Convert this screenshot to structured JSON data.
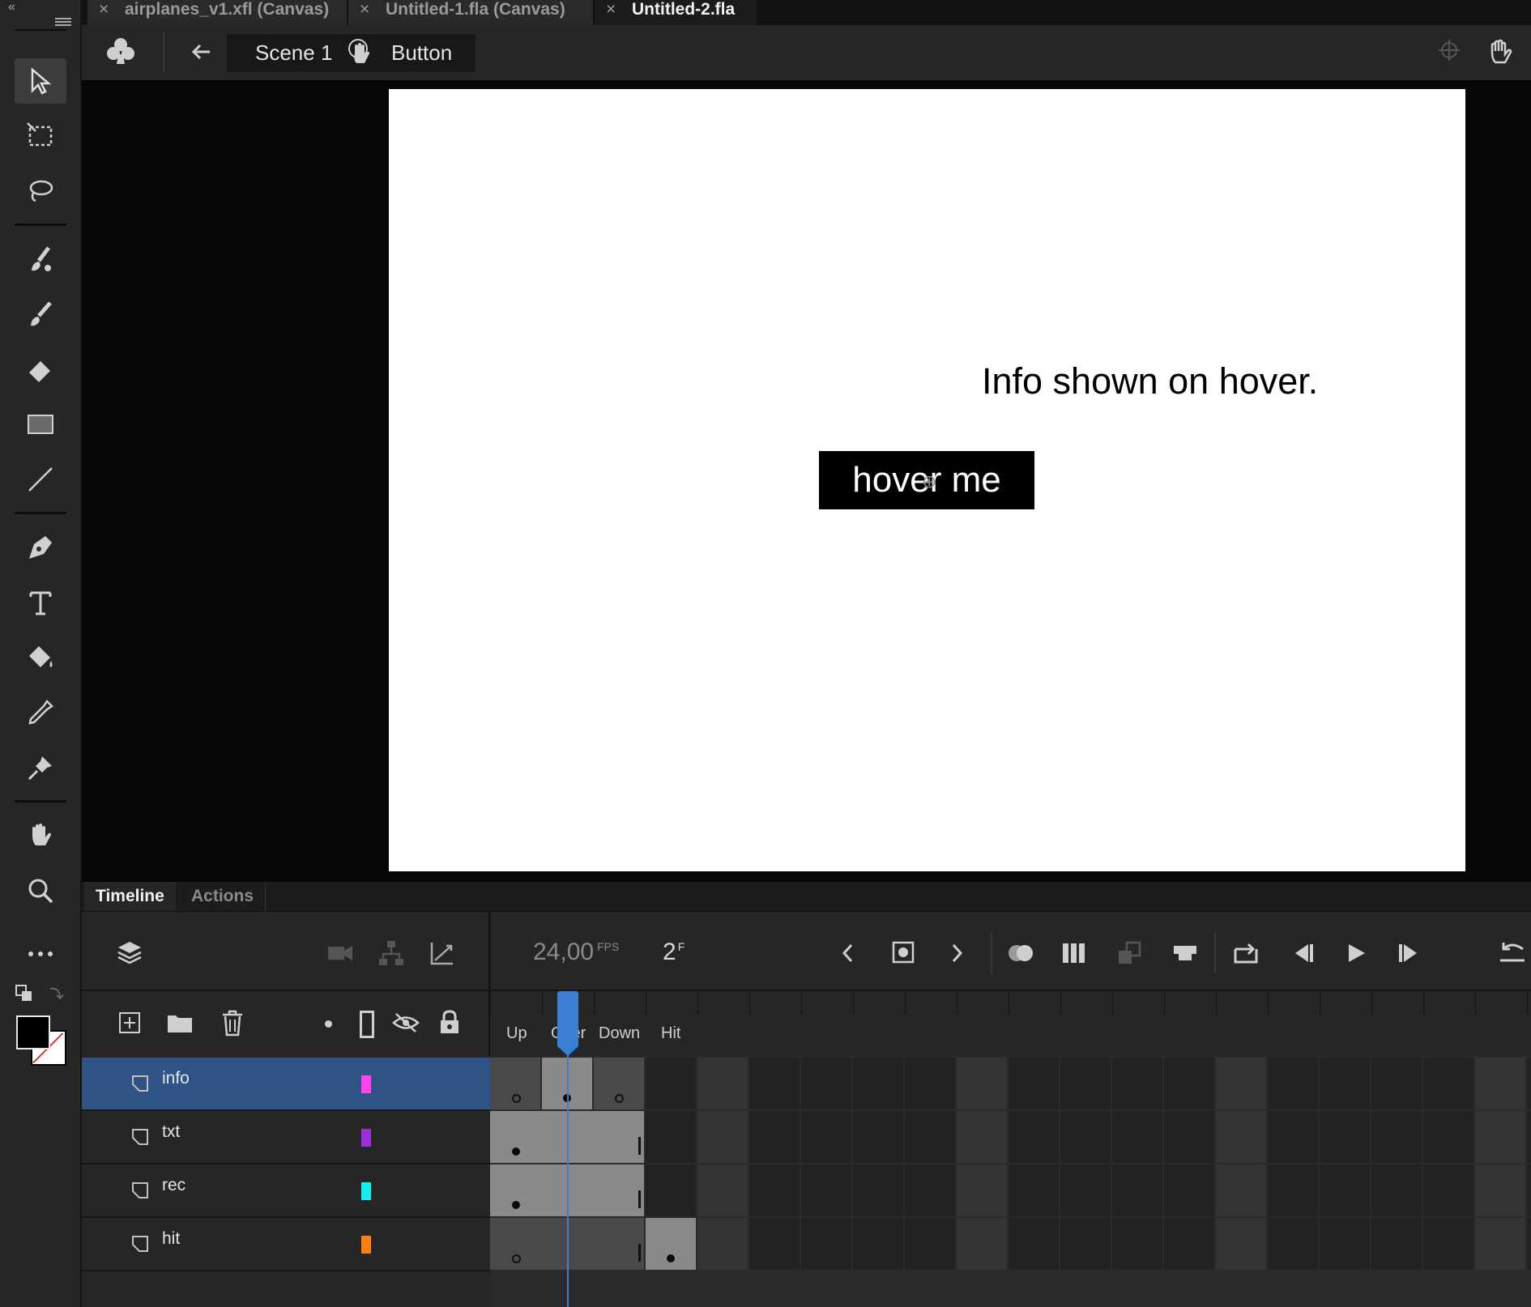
{
  "tabs": [
    {
      "label": "airplanes_v1.xfl (Canvas)",
      "active": false
    },
    {
      "label": "Untitled-1.fla (Canvas)",
      "active": false
    },
    {
      "label": "Untitled-2.fla",
      "active": true
    }
  ],
  "breadcrumb": {
    "scene": "Scene 1",
    "symbol": "Button"
  },
  "stage": {
    "info_text": "Info shown on hover.",
    "button_text": "hover me",
    "background": "#ffffff"
  },
  "panel_tabs": {
    "timeline": "Timeline",
    "actions": "Actions"
  },
  "timeline": {
    "fps_value": "24,00",
    "fps_unit": "FPS",
    "frame_value": "2",
    "frame_unit": "F",
    "frame_labels": [
      "Up",
      "Over",
      "Down",
      "Hit"
    ],
    "current_frame": 2,
    "layers": [
      {
        "name": "info",
        "color": "#ff44ee",
        "selected": true
      },
      {
        "name": "txt",
        "color": "#9b30d9",
        "selected": false
      },
      {
        "name": "rec",
        "color": "#14f0f0",
        "selected": false
      },
      {
        "name": "hit",
        "color": "#ff7f11",
        "selected": false
      }
    ]
  },
  "colors": {
    "stroke": "#000000",
    "fill": "#ffffff",
    "playhead": "#3b7fd4",
    "selection": "#2e5384"
  },
  "icons": [
    "select-tool-icon",
    "free-transform-icon",
    "lasso-icon",
    "fluid-brush-icon",
    "brush-icon",
    "eraser-icon",
    "rectangle-icon",
    "line-icon",
    "pen-icon",
    "text-icon",
    "paint-bucket-icon",
    "eyedropper-icon",
    "pin-icon",
    "hand-icon",
    "zoom-icon",
    "more-icon"
  ]
}
